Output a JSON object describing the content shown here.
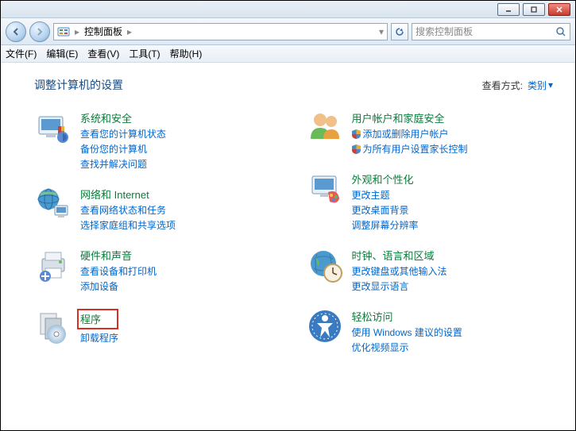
{
  "address": {
    "location": "控制面板"
  },
  "search": {
    "placeholder": "搜索控制面板"
  },
  "menu": {
    "file": "文件(F)",
    "edit": "编辑(E)",
    "view": "查看(V)",
    "tools": "工具(T)",
    "help": "帮助(H)"
  },
  "header": {
    "title": "调整计算机的设置",
    "viewby_label": "查看方式:",
    "viewby_value": "类别"
  },
  "left": [
    {
      "title": "系统和安全",
      "links": [
        "查看您的计算机状态",
        "备份您的计算机",
        "查找并解决问题"
      ]
    },
    {
      "title": "网络和 Internet",
      "links": [
        "查看网络状态和任务",
        "选择家庭组和共享选项"
      ]
    },
    {
      "title": "硬件和声音",
      "links": [
        "查看设备和打印机",
        "添加设备"
      ]
    },
    {
      "title": "程序",
      "links": [
        "卸载程序"
      ],
      "highlight": true
    }
  ],
  "right": [
    {
      "title": "用户帐户和家庭安全",
      "links": [
        "添加或删除用户帐户",
        "为所有用户设置家长控制"
      ],
      "shields": [
        true,
        true
      ]
    },
    {
      "title": "外观和个性化",
      "links": [
        "更改主题",
        "更改桌面背景",
        "调整屏幕分辨率"
      ]
    },
    {
      "title": "时钟、语言和区域",
      "links": [
        "更改键盘或其他输入法",
        "更改显示语言"
      ]
    },
    {
      "title": "轻松访问",
      "links": [
        "使用 Windows 建议的设置",
        "优化视频显示"
      ]
    }
  ]
}
